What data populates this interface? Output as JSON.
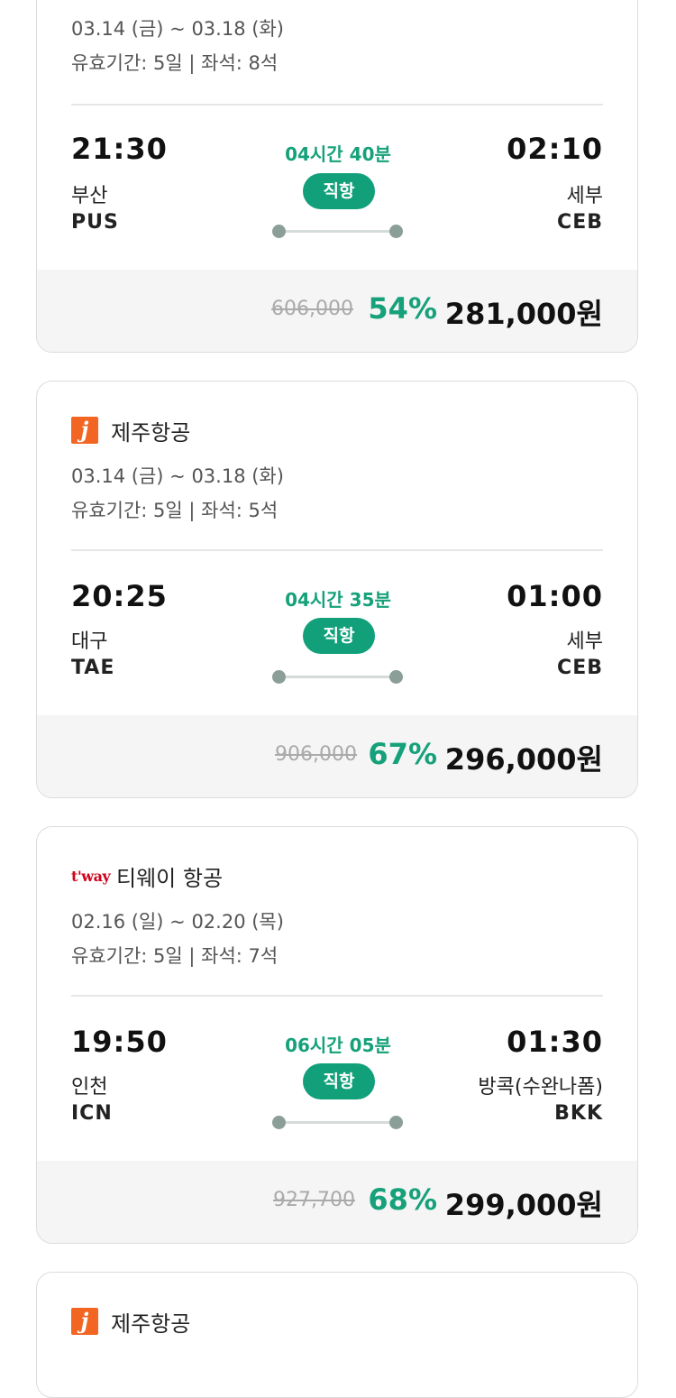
{
  "cards": [
    {
      "dates": "03.14 (금) ~ 03.18 (화)",
      "validity": "유효기간: 5일 | 좌석: 8석",
      "depart_time": "21:30",
      "depart_city": "부산",
      "depart_code": "PUS",
      "arrive_time": "02:10",
      "arrive_city": "세부",
      "arrive_code": "CEB",
      "duration": "04시간 40분",
      "direct": "직항",
      "original_price": "606,000",
      "discount": "54%",
      "price": "281,000원"
    },
    {
      "airline_name": "제주항공",
      "airline_logo": "jeju-air-logo",
      "logo_text": "j",
      "dates": "03.14 (금) ~ 03.18 (화)",
      "validity": "유효기간: 5일 | 좌석: 5석",
      "depart_time": "20:25",
      "depart_city": "대구",
      "depart_code": "TAE",
      "arrive_time": "01:00",
      "arrive_city": "세부",
      "arrive_code": "CEB",
      "duration": "04시간 35분",
      "direct": "직항",
      "original_price": "906,000",
      "discount": "67%",
      "price": "296,000원"
    },
    {
      "airline_name": "티웨이 항공",
      "airline_logo": "tway-logo",
      "logo_text": "t'way",
      "dates": "02.16 (일) ~ 02.20 (목)",
      "validity": "유효기간: 5일 | 좌석: 7석",
      "depart_time": "19:50",
      "depart_city": "인천",
      "depart_code": "ICN",
      "arrive_time": "01:30",
      "arrive_city": "방콕(수완나폼)",
      "arrive_code": "BKK",
      "duration": "06시간 05분",
      "direct": "직항",
      "original_price": "927,700",
      "discount": "68%",
      "price": "299,000원"
    },
    {
      "airline_name": "제주항공",
      "airline_logo": "jeju-air-logo",
      "logo_text": "j"
    }
  ],
  "colors": {
    "accent_green": "#16a17a",
    "direct_badge": "#11a07a",
    "jeju_orange": "#f26522",
    "tway_red": "#d0021b"
  }
}
